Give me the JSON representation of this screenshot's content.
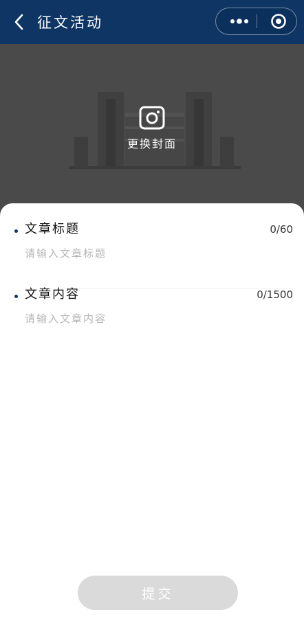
{
  "nav": {
    "title": "征文活动",
    "back_icon": "chevron-left-icon",
    "more_icon": "more-dots-icon",
    "close_icon": "target-circle-icon",
    "bg_color": "#0e3564"
  },
  "cover": {
    "change_label": "更换封面",
    "camera_icon": "camera-icon"
  },
  "form": {
    "title_field": {
      "label": "文章标题",
      "count": "0/60",
      "placeholder": "请输入文章标题"
    },
    "content_field": {
      "label": "文章内容",
      "count": "0/1500",
      "placeholder": "请输入文章内容"
    }
  },
  "submit": {
    "label": "提交",
    "color": "#dadada"
  }
}
